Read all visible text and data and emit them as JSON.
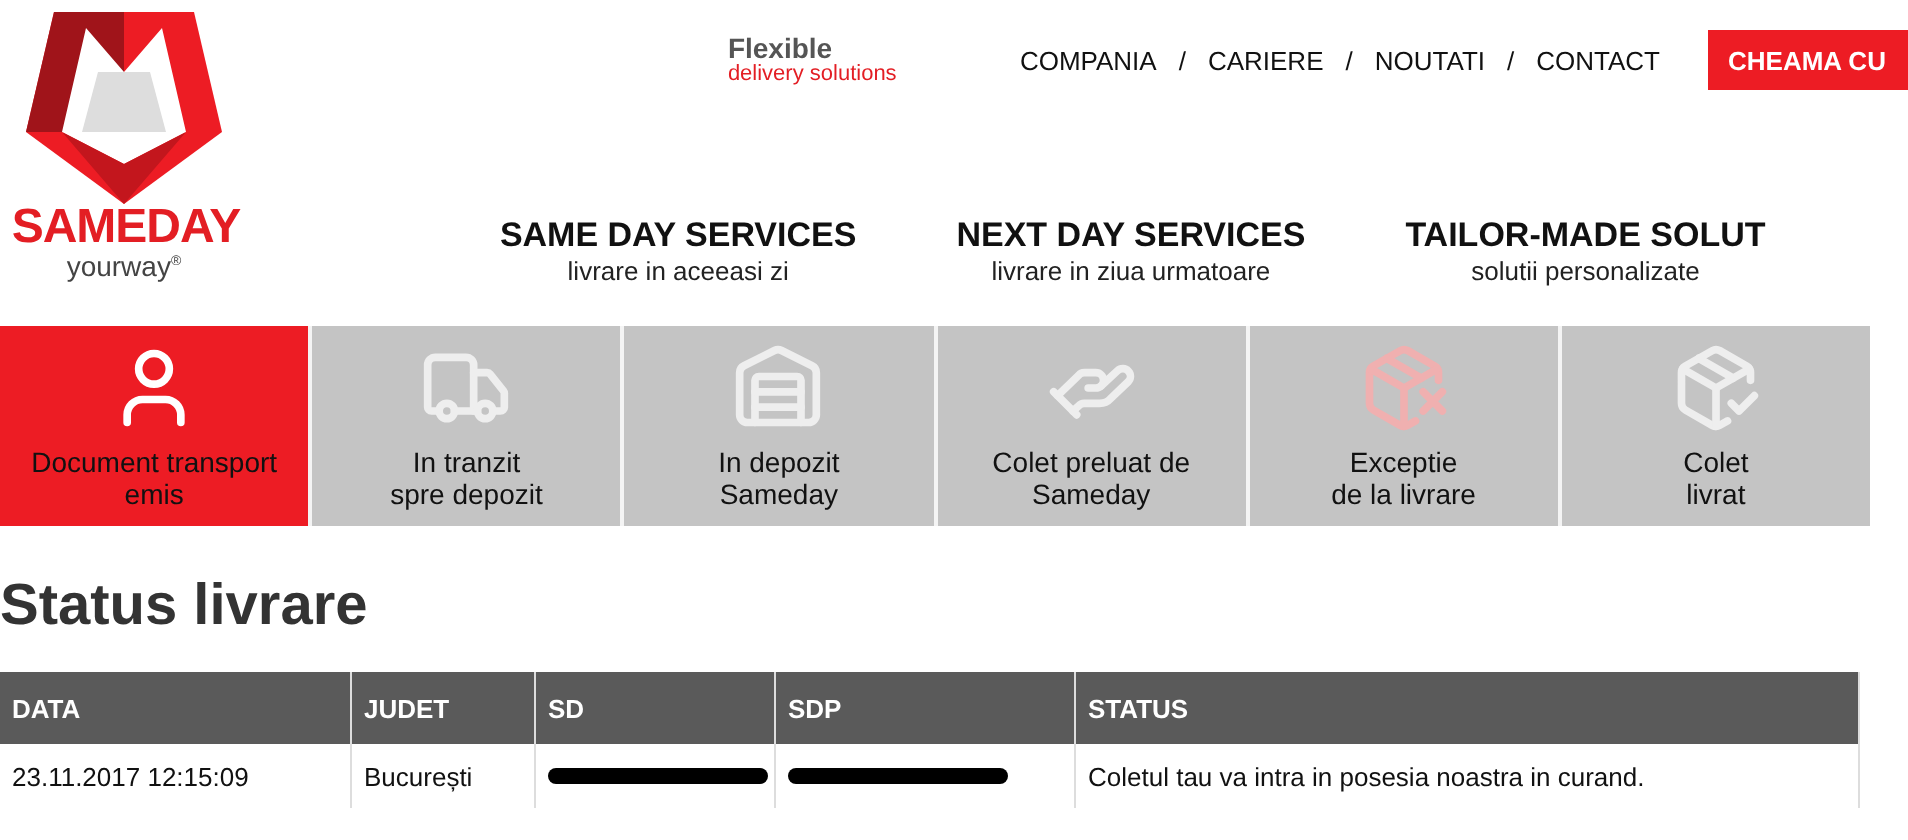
{
  "logo": {
    "name": "SAMEDAY",
    "tagline": "yourway",
    "mark": "®"
  },
  "slogan": {
    "line_1": "Flexible",
    "line_2": "delivery solutions"
  },
  "top_nav": [
    "COMPANIA",
    "CARIERE",
    "NOUTATI",
    "CONTACT"
  ],
  "top_nav_separator": "/",
  "call_button": "CHEAMA CU",
  "services": [
    {
      "title": "SAME DAY SERVICES",
      "subtitle": "livrare in aceeasi zi"
    },
    {
      "title": "NEXT DAY SERVICES",
      "subtitle": "livrare in ziua urmatoare"
    },
    {
      "title": "TAILOR-MADE SOLUT",
      "subtitle": "solutii personalizate"
    }
  ],
  "steps": [
    {
      "kind": "issued",
      "label": "Document transport\nemis",
      "selected": true
    },
    {
      "kind": "transit",
      "label": "In tranzit\nspre depozit",
      "selected": false
    },
    {
      "kind": "warehouse",
      "label": "In depozit\nSameday",
      "selected": false
    },
    {
      "kind": "pickup",
      "label": "Colet preluat de\nSameday",
      "selected": false
    },
    {
      "kind": "exception",
      "label": "Exceptie\nde la livrare",
      "selected": false
    },
    {
      "kind": "delivered",
      "label": "Colet\nlivrat",
      "selected": false
    }
  ],
  "title": "Status livrare",
  "table": {
    "columns": [
      "DATA",
      "JUDET",
      "SD",
      "SDP",
      "STATUS"
    ],
    "rows": [
      {
        "cells": [
          {
            "kind": "text",
            "text": "23.11.2017 12:15:09"
          },
          {
            "kind": "text",
            "text": "București"
          },
          {
            "kind": "redacted"
          },
          {
            "kind": "redacted"
          },
          {
            "kind": "text",
            "text": "Coletul tau va intra in posesia noastra in curand."
          }
        ]
      }
    ]
  }
}
